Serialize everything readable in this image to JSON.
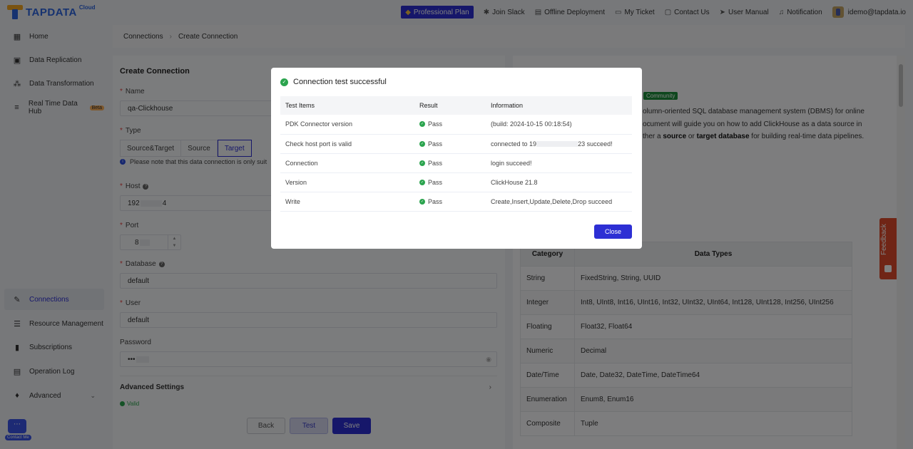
{
  "brand": {
    "name": "TAPDATA",
    "suffix": "Cloud"
  },
  "topnav": {
    "plan": "Professional Plan",
    "join_slack": "Join Slack",
    "offline": "Offline Deployment",
    "ticket": "My Ticket",
    "contact": "Contact Us",
    "manual": "User Manual",
    "notification": "Notification",
    "user": "idemo@tapdata.io"
  },
  "sidebar": {
    "items": [
      {
        "label": "Home"
      },
      {
        "label": "Data Replication"
      },
      {
        "label": "Data Transformation"
      },
      {
        "label": "Real Time Data Hub",
        "badge": "Beta"
      },
      {
        "label": "Connections"
      },
      {
        "label": "Resource Management"
      },
      {
        "label": "Subscriptions"
      },
      {
        "label": "Operation Log"
      },
      {
        "label": "Advanced"
      }
    ],
    "contact_me": "Contact Me"
  },
  "breadcrumb": {
    "parent": "Connections",
    "current": "Create Connection"
  },
  "form": {
    "title": "Create Connection",
    "name_label": "Name",
    "name_value": "qa-Clickhouse",
    "type_label": "Type",
    "types": [
      "Source&Target",
      "Source",
      "Target"
    ],
    "type_note": "Please note that this data connection is only suit",
    "host_label": "Host",
    "host_prefix": "192",
    "host_suffix": "4",
    "port_label": "Port",
    "port_value": "8",
    "database_label": "Database",
    "database_value": "default",
    "user_label": "User",
    "user_value": "default",
    "password_label": "Password",
    "password_value": "•••",
    "advanced": "Advanced Settings",
    "valid": "Valid",
    "back": "Back",
    "test": "Test",
    "save": "Save"
  },
  "doc": {
    "badge": "Community",
    "line1": "olumn-oriented SQL database management system (DBMS) for online",
    "line2": "ocument will guide you on how to add ClickHouse as a data source in",
    "line3_pre": "ther a ",
    "line3_b1": "source",
    "line3_mid": " or ",
    "line3_b2": "target database",
    "line3_post": " for building real-time data pipelines.",
    "table_headers": [
      "Category",
      "Data Types"
    ],
    "table_rows": [
      [
        "String",
        "FixedString, String, UUID"
      ],
      [
        "Integer",
        "Int8, UInt8, Int16, UInt16, Int32, UInt32, UInt64, Int128, UInt128, Int256, UInt256"
      ],
      [
        "Floating",
        "Float32, Float64"
      ],
      [
        "Numeric",
        "Decimal"
      ],
      [
        "Date/Time",
        "Date, Date32, DateTime, DateTime64"
      ],
      [
        "Enumeration",
        "Enum8, Enum16"
      ],
      [
        "Composite",
        "Tuple"
      ]
    ]
  },
  "feedback": "Feedback",
  "modal": {
    "title": "Connection test successful",
    "headers": [
      "Test Items",
      "Result",
      "Information"
    ],
    "rows": [
      {
        "item": "PDK Connector version",
        "result": "Pass",
        "info": "(build: 2024-10-15 00:18:54)"
      },
      {
        "item": "Check host port is valid",
        "result": "Pass",
        "info_pre": "connected to 19",
        "info_post": "23 succeed!"
      },
      {
        "item": "Connection",
        "result": "Pass",
        "info": "login succeed!"
      },
      {
        "item": "Version",
        "result": "Pass",
        "info": "ClickHouse 21.8"
      },
      {
        "item": "Write",
        "result": "Pass",
        "info": "Create,Insert,Update,Delete,Drop succeed"
      }
    ],
    "close": "Close"
  },
  "colors": {
    "primary": "#2d2fd4",
    "success": "#2ba44e",
    "feedback": "#e04a2d",
    "community": "#1d8e3a"
  }
}
